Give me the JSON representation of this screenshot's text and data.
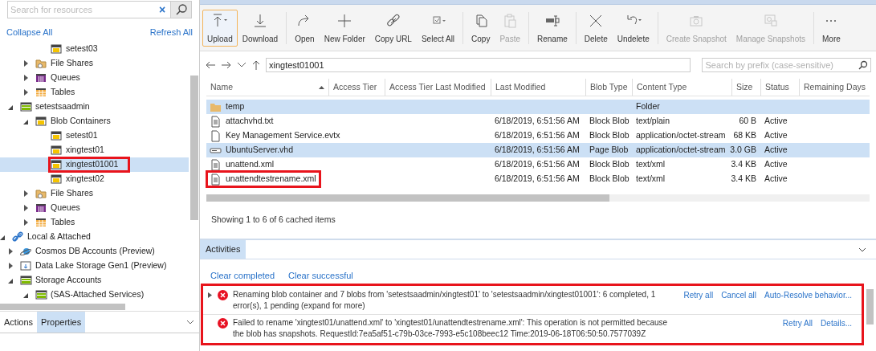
{
  "explorer": {
    "search": {
      "placeholder": "Search for resources",
      "clear": "×"
    },
    "links": [
      "Collapse All",
      "Refresh All"
    ],
    "tree": [
      {
        "children": [
          {
            "children": [
              {
                "children": [
                  {
                    "label": "setest03",
                    "kind": "container",
                    "selected": false,
                    "annotated": false
                  }
                ]
              },
              {
                "label": "File Shares",
                "kind": "fileshare",
                "expanded": false,
                "selected": false,
                "annotated": false
              },
              {
                "label": "Queues",
                "kind": "queue",
                "expanded": false,
                "selected": false,
                "annotated": false
              },
              {
                "label": "Tables",
                "kind": "table",
                "expanded": false,
                "selected": false,
                "annotated": false
              }
            ]
          },
          {
            "label": "setestsaadmin",
            "kind": "account",
            "expanded": true,
            "selected": false,
            "annotated": false,
            "children": [
              {
                "label": "Blob Containers",
                "kind": "container",
                "expanded": true,
                "selected": false,
                "annotated": false,
                "children": [
                  {
                    "label": "setest01",
                    "kind": "container",
                    "selected": false,
                    "annotated": false
                  },
                  {
                    "label": "xingtest01",
                    "kind": "container",
                    "selected": false,
                    "annotated": false
                  },
                  {
                    "label": "xingtest01001",
                    "kind": "container",
                    "selected": true,
                    "annotated": true
                  },
                  {
                    "label": "xingtest02",
                    "kind": "container",
                    "selected": false,
                    "annotated": false
                  }
                ]
              },
              {
                "label": "File Shares",
                "kind": "fileshare",
                "expanded": false,
                "selected": false,
                "annotated": false
              },
              {
                "label": "Queues",
                "kind": "queue",
                "expanded": false,
                "selected": false,
                "annotated": false
              },
              {
                "label": "Tables",
                "kind": "table",
                "expanded": false,
                "selected": false,
                "annotated": false
              }
            ]
          }
        ]
      },
      {
        "label": "Local & Attached",
        "kind": "link",
        "expanded": true,
        "selected": false,
        "annotated": false,
        "children": [
          {
            "label": "Cosmos DB Accounts (Preview)",
            "kind": "cosmos",
            "expanded": false,
            "selected": false,
            "annotated": false
          },
          {
            "label": "Data Lake Storage Gen1 (Preview)",
            "kind": "datalake",
            "expanded": false,
            "selected": false,
            "annotated": false
          },
          {
            "label": "Storage Accounts",
            "kind": "account",
            "expanded": true,
            "selected": false,
            "annotated": false,
            "children": [
              {
                "label": "(SAS-Attached Services)",
                "kind": "account",
                "expanded": true,
                "selected": false,
                "annotated": false
              }
            ]
          }
        ]
      }
    ],
    "bottom_tabs": [
      {
        "label": "Actions",
        "selected": false
      },
      {
        "label": "Properties",
        "selected": true
      }
    ]
  },
  "toolbar": [
    [
      {
        "label": "Upload",
        "kind": "upload",
        "disabled": false,
        "selected": true
      },
      {
        "label": "Download",
        "kind": "download",
        "disabled": false,
        "selected": false
      }
    ],
    [
      {
        "label": "Open",
        "kind": "open",
        "disabled": false,
        "selected": false
      },
      {
        "label": "New Folder",
        "kind": "plus",
        "disabled": false,
        "selected": false
      },
      {
        "label": "Copy URL",
        "kind": "link",
        "disabled": false,
        "selected": false
      },
      {
        "label": "Select All",
        "kind": "selectall",
        "disabled": false,
        "selected": false
      }
    ],
    [
      {
        "label": "Copy",
        "kind": "copy",
        "disabled": false,
        "selected": false
      },
      {
        "label": "Paste",
        "kind": "paste",
        "disabled": true,
        "selected": false
      }
    ],
    [
      {
        "label": "Rename",
        "kind": "rename",
        "disabled": false,
        "selected": false
      }
    ],
    [
      {
        "label": "Delete",
        "kind": "delete",
        "disabled": false,
        "selected": false
      },
      {
        "label": "Undelete",
        "kind": "undo",
        "disabled": false,
        "selected": false
      }
    ],
    [
      {
        "label": "Create Snapshot",
        "kind": "camera",
        "disabled": true,
        "selected": false
      },
      {
        "label": "Manage Snapshots",
        "kind": "snapshots",
        "disabled": true,
        "selected": false
      }
    ],
    [
      {
        "label": "More",
        "kind": "more",
        "disabled": false,
        "selected": false
      }
    ]
  ],
  "path": {
    "value": "xingtest01001",
    "search_placeholder": "Search by prefix (case-sensitive)"
  },
  "table": {
    "columns": [
      {
        "label": "Name",
        "sorted": true
      },
      {
        "label": "Access Tier",
        "sorted": false
      },
      {
        "label": "Access Tier Last Modified",
        "sorted": false
      },
      {
        "label": "Last Modified",
        "sorted": false
      },
      {
        "label": "Blob Type",
        "sorted": false
      },
      {
        "label": "Content Type",
        "sorted": false
      },
      {
        "label": "Size",
        "sorted": false
      },
      {
        "label": "Status",
        "sorted": false
      },
      {
        "label": "Remaining Days",
        "sorted": false
      }
    ],
    "rows": [
      {
        "kind": "folder",
        "name": "temp",
        "content_type": "Folder",
        "selected": true,
        "annotated": false
      },
      {
        "kind": "text",
        "name": "attachvhd.txt",
        "last_modified": "6/18/2019, 6:51:56 AM",
        "blob_type": "Block Blob",
        "content_type": "text/plain",
        "size": "60 B",
        "status": "Active",
        "selected": false,
        "annotated": false
      },
      {
        "kind": "file",
        "name": "Key Management Service.evtx",
        "last_modified": "6/18/2019, 6:51:56 AM",
        "blob_type": "Block Blob",
        "content_type": "application/octet-stream",
        "size": "68 KB",
        "status": "Active",
        "selected": false,
        "annotated": false
      },
      {
        "kind": "disk",
        "name": "UbuntuServer.vhd",
        "last_modified": "6/18/2019, 6:51:56 AM",
        "blob_type": "Page Blob",
        "content_type": "application/octet-stream",
        "size": "3.0 GB",
        "status": "Active",
        "selected": true,
        "annotated": false
      },
      {
        "kind": "text",
        "name": "unattend.xml",
        "last_modified": "6/18/2019, 6:51:56 AM",
        "blob_type": "Block Blob",
        "content_type": "text/xml",
        "size": "3.4 KB",
        "status": "Active",
        "selected": false,
        "annotated": false
      },
      {
        "kind": "text",
        "name": "unattendtestrename.xml",
        "last_modified": "6/18/2019, 6:51:56 AM",
        "blob_type": "Block Blob",
        "content_type": "text/xml",
        "size": "3.4 KB",
        "status": "Active",
        "selected": false,
        "annotated": true
      }
    ],
    "footer": "Showing 1 to 6 of 6 cached items"
  },
  "activities": {
    "tab": {
      "label": "Activities",
      "selected": true
    },
    "links": [
      "Clear completed",
      "Clear successful"
    ],
    "annotated": true,
    "items": [
      {
        "kind": "error",
        "expanded": false,
        "message": "Renaming blob container and 7 blobs from 'setestsaadmin/xingtest01' to 'setestsaadmin/xingtest01001': 6 completed, 1 error(s), 1 pending (expand for more)",
        "actions": [
          "Retry all",
          "Cancel all",
          "Auto-Resolve behavior..."
        ]
      },
      {
        "kind": "error",
        "message": "Failed to rename 'xingtest01/unattend.xml' to 'xingtest01/unattendtestrename.xml': This operation is not permitted because the blob has snapshots. RequestId:7ea5af51-c79b-03ce-7993-e5c108beec12 Time:2019-06-18T06:50:50.7577039Z",
        "actions": [
          "Retry All",
          "Details..."
        ]
      }
    ]
  }
}
